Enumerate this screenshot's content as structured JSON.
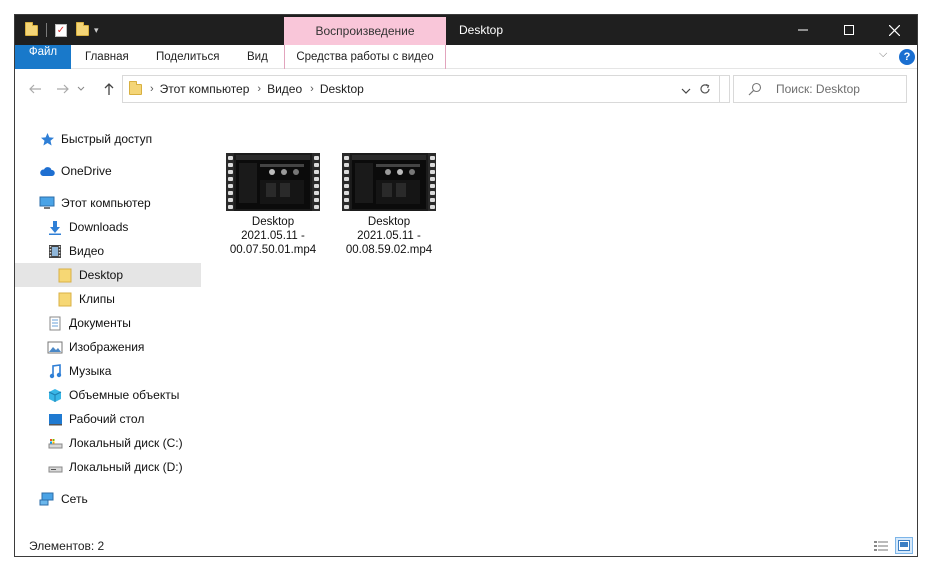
{
  "window": {
    "title": "Desktop",
    "contextual_tab": "Воспроизведение",
    "controls": {
      "minimize": "—",
      "maximize": "☐",
      "close": "✕"
    }
  },
  "ribbon": {
    "tabs": [
      "Файл",
      "Главная",
      "Поделиться",
      "Вид"
    ],
    "contextual_tab": "Средства работы с видео",
    "help": "?"
  },
  "address": {
    "crumbs": [
      "Этот компьютер",
      "Видео",
      "Desktop"
    ],
    "search_placeholder": "Поиск: Desktop"
  },
  "sidebar": {
    "items": [
      {
        "label": "Быстрый доступ",
        "icon": "star-icon"
      },
      {
        "label": "OneDrive",
        "icon": "cloud-icon"
      },
      {
        "label": "Этот компьютер",
        "icon": "computer-icon"
      },
      {
        "label": "Downloads",
        "icon": "download-icon"
      },
      {
        "label": "Видео",
        "icon": "video-icon"
      },
      {
        "label": "Desktop",
        "icon": "folder-icon",
        "selected": true
      },
      {
        "label": "Клипы",
        "icon": "folder-icon"
      },
      {
        "label": "Документы",
        "icon": "document-icon"
      },
      {
        "label": "Изображения",
        "icon": "pictures-icon"
      },
      {
        "label": "Музыка",
        "icon": "music-icon"
      },
      {
        "label": "Объемные объекты",
        "icon": "3d-objects-icon"
      },
      {
        "label": "Рабочий стол",
        "icon": "desktop-icon"
      },
      {
        "label": "Локальный диск (C:)",
        "icon": "drive-icon"
      },
      {
        "label": "Локальный диск (D:)",
        "icon": "drive-icon"
      },
      {
        "label": "Сеть",
        "icon": "network-icon"
      }
    ]
  },
  "files": [
    {
      "name_line1": "Desktop",
      "name_line2": "2021.05.11 -",
      "name_line3": "00.07.50.01.mp4"
    },
    {
      "name_line1": "Desktop",
      "name_line2": "2021.05.11 -",
      "name_line3": "00.08.59.02.mp4"
    }
  ],
  "status": {
    "count": "Элементов: 2"
  },
  "colors": {
    "file_tab": "#1979ca",
    "contextual": "#f9c6d9",
    "titlebar": "#1f1f1f",
    "selected": "#e5e5e5"
  }
}
